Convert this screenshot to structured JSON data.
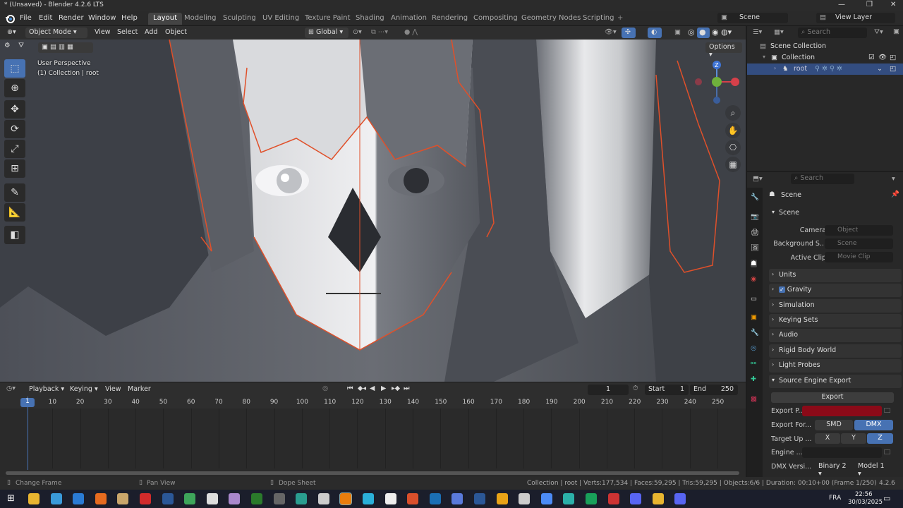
{
  "window": {
    "title": "* (Unsaved) - Blender 4.2.6 LTS",
    "controls": [
      "—",
      "❐",
      "✕"
    ]
  },
  "menu": [
    "File",
    "Edit",
    "Render",
    "Window",
    "Help"
  ],
  "workspaces": [
    "Layout",
    "Modeling",
    "Sculpting",
    "UV Editing",
    "Texture Paint",
    "Shading",
    "Animation",
    "Rendering",
    "Compositing",
    "Geometry Nodes",
    "Scripting"
  ],
  "active_workspace": "Layout",
  "scene": {
    "name": "Scene",
    "view_layer": "View Layer"
  },
  "viewport": {
    "mode": "Object Mode",
    "menus": [
      "View",
      "Select",
      "Add",
      "Object"
    ],
    "orientation": "Global",
    "options": "Options",
    "perspective": "User Perspective",
    "context": "(1) Collection | root",
    "gizmo": {
      "z": "Z"
    }
  },
  "outliner": {
    "search_placeholder": "Search",
    "scene_collection": "Scene Collection",
    "collection": "Collection",
    "object": "root"
  },
  "properties": {
    "search_placeholder": "Search",
    "context": "Scene",
    "scene_panel": "Scene",
    "camera_label": "Camera",
    "camera_placeholder": "Object",
    "background_label": "Background S...",
    "background_placeholder": "Scene",
    "active_clip_label": "Active Clip",
    "active_clip_placeholder": "Movie Clip",
    "panels": [
      "Units",
      "Gravity",
      "Simulation",
      "Keying Sets",
      "Audio",
      "Rigid Body World",
      "Light Probes"
    ],
    "gravity_checked": true,
    "source_engine": {
      "title": "Source Engine Export",
      "export_btn": "Export",
      "export_path_label": "Export P...",
      "export_format_label": "Export For...",
      "formats": [
        "SMD",
        "DMX"
      ],
      "active_format": "DMX",
      "target_up_label": "Target Up ...",
      "axes": [
        "X",
        "Y",
        "Z"
      ],
      "active_axis": "Z",
      "engine_label": "Engine ...",
      "dmx_version_label": "DMX Versi...",
      "dmx_binary": "Binary 2",
      "dmx_model": "Model 1",
      "accent": "#8b0a18"
    }
  },
  "timeline": {
    "menus": [
      "Playback",
      "Keying",
      "View",
      "Marker"
    ],
    "current_frame": "1",
    "start_label": "Start",
    "start": "1",
    "end_label": "End",
    "end": "250",
    "ticks": [
      "1",
      "10",
      "20",
      "30",
      "40",
      "50",
      "60",
      "70",
      "80",
      "90",
      "100",
      "110",
      "120",
      "130",
      "140",
      "150",
      "160",
      "170",
      "180",
      "190",
      "200",
      "210",
      "220",
      "230",
      "240",
      "250"
    ]
  },
  "status": {
    "left": "Change Frame",
    "middle": "Pan View",
    "right": "Dope Sheet",
    "info": "Collection | root | Verts:177,534 | Faces:59,295 | Tris:59,295 | Objects:6/6 | Duration: 00:10+00 (Frame 1/250)",
    "version": "4.2.6"
  },
  "taskbar": {
    "lang": "FRA",
    "time": "22:56",
    "date": "30/03/2025"
  }
}
